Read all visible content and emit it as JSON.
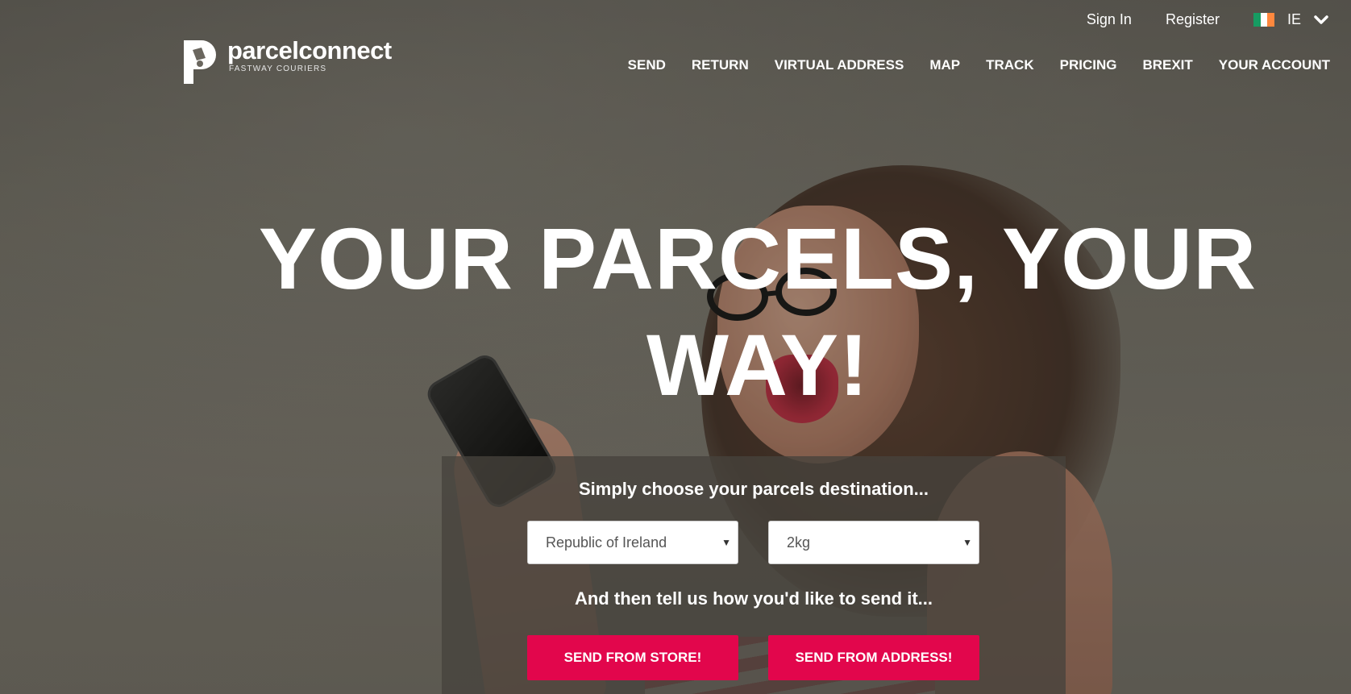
{
  "brand": {
    "name": "parcelconnect",
    "subtitle": "FASTWAY COURIERS"
  },
  "topbar": {
    "sign_in": "Sign In",
    "register": "Register",
    "lang_code": "IE",
    "flag_colors": [
      "#169b62",
      "#ffffff",
      "#ff883e"
    ]
  },
  "nav": {
    "items": [
      "SEND",
      "RETURN",
      "VIRTUAL ADDRESS",
      "MAP",
      "TRACK",
      "PRICING",
      "BREXIT",
      "YOUR ACCOUNT"
    ]
  },
  "hero": {
    "line1": "YOUR PARCELS, YOUR",
    "line2": "WAY!"
  },
  "form": {
    "heading1": "Simply choose your parcels destination...",
    "destination": "Republic of Ireland",
    "weight": "2kg",
    "heading2": "And then tell us how you'd like to send it...",
    "btn_store": "SEND FROM STORE!",
    "btn_address": "SEND FROM ADDRESS!"
  },
  "colors": {
    "accent": "#e2064c"
  }
}
